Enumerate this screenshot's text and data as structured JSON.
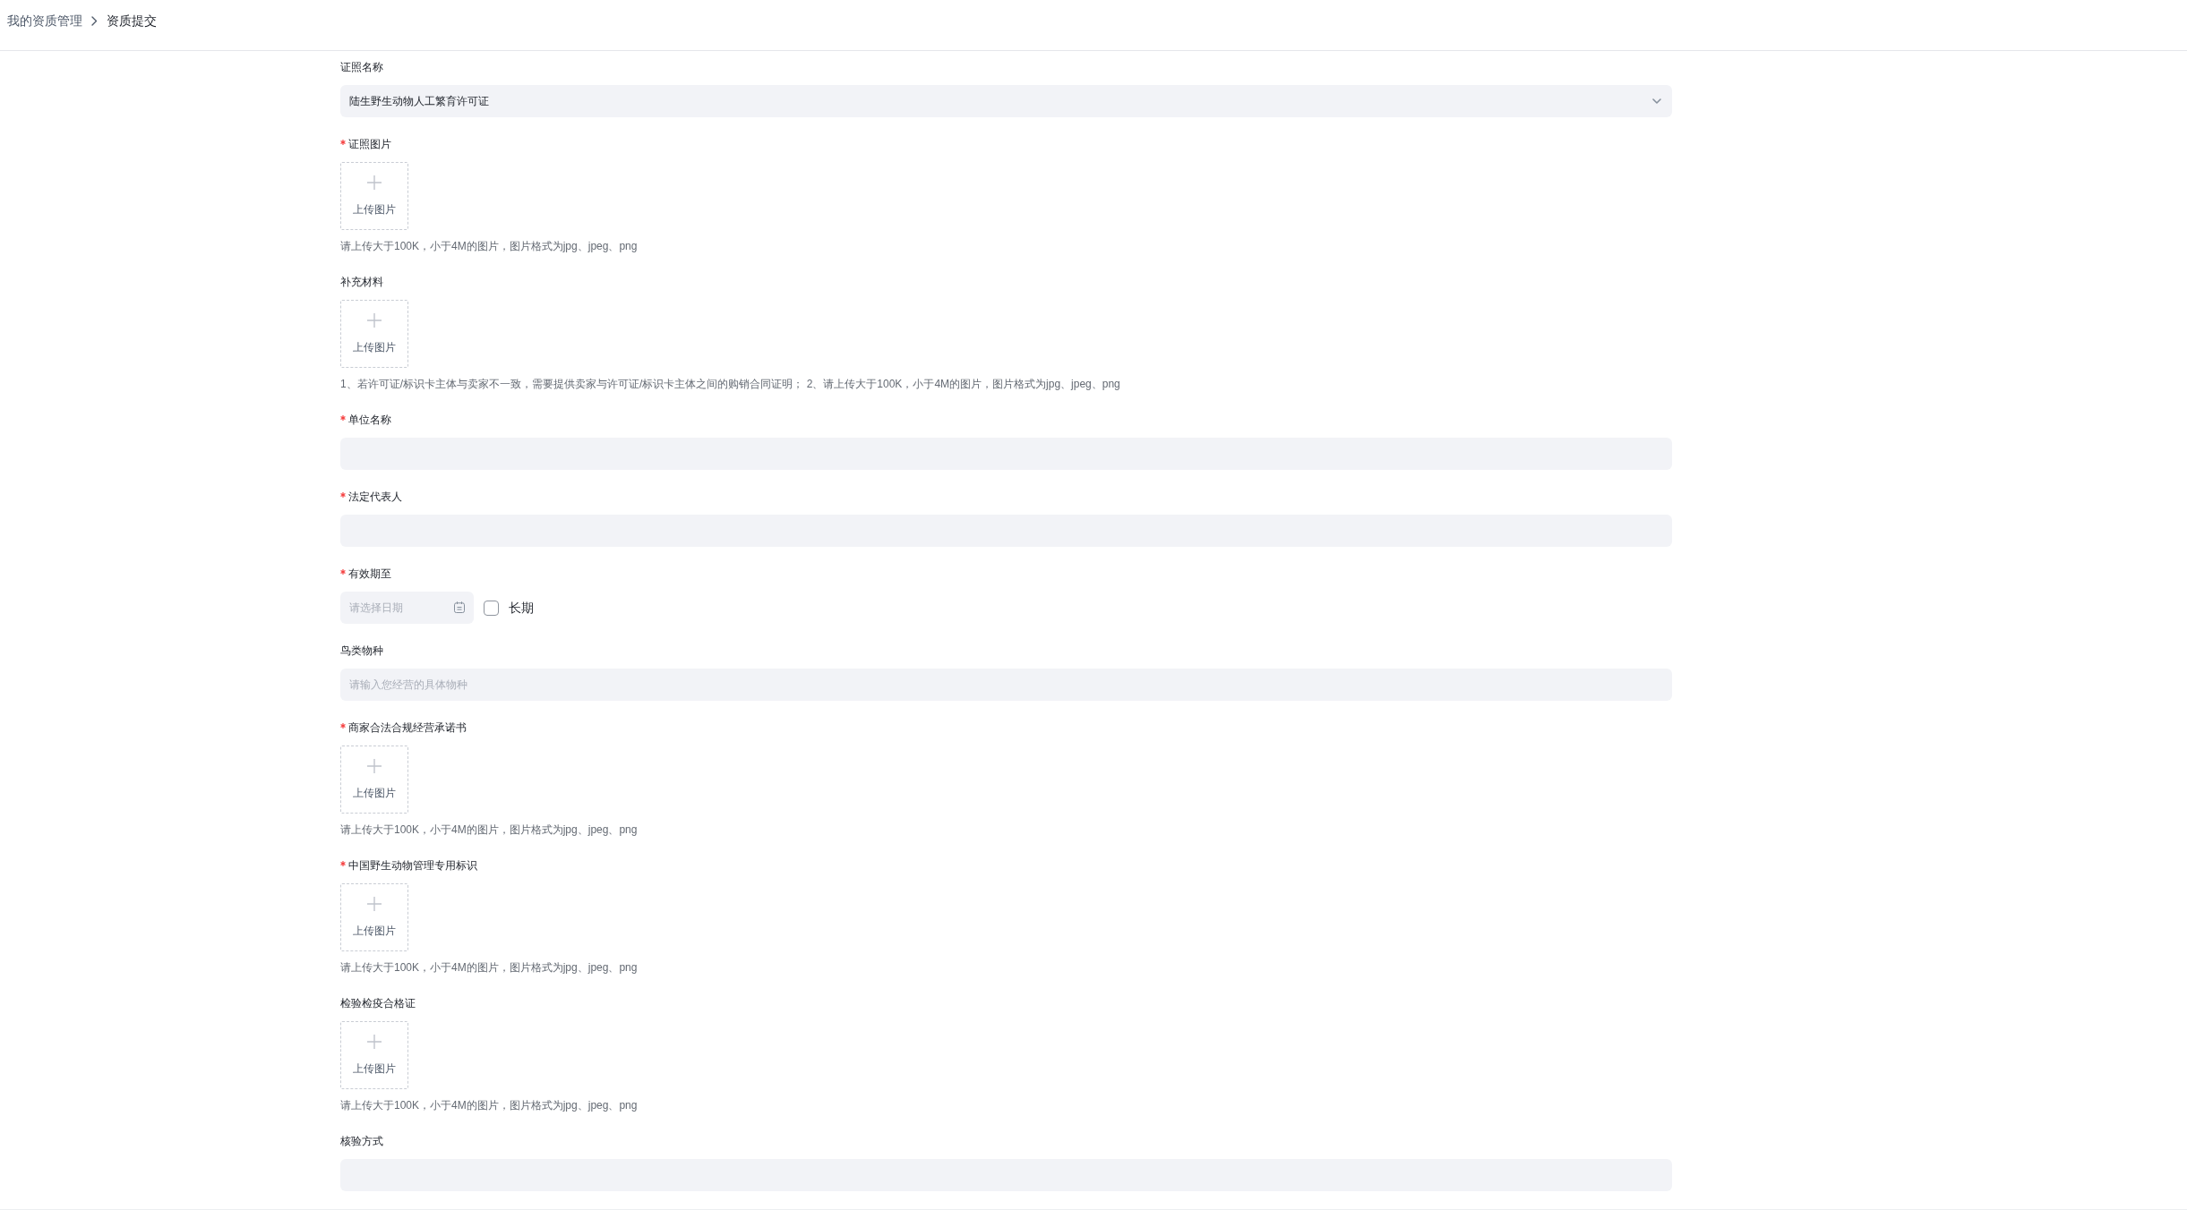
{
  "breadcrumb": [
    {
      "label": "我的资质管理",
      "current": false
    },
    {
      "label": "资质提交",
      "current": true
    }
  ],
  "form": {
    "fields": [
      {
        "kind": "select",
        "label": "证照名称",
        "required": false,
        "value": "陆生野生动物人工繁育许可证"
      },
      {
        "kind": "upload",
        "label": "证照图片",
        "required": true,
        "button": "上传图片",
        "hint": "请上传大于100K，小于4M的图片，图片格式为jpg、jpeg、png"
      },
      {
        "kind": "upload",
        "label": "补充材料",
        "required": false,
        "button": "上传图片",
        "hint": "1、若许可证/标识卡主体与卖家不一致，需要提供卖家与许可证/标识卡主体之间的购销合同证明； 2、请上传大于100K，小于4M的图片，图片格式为jpg、jpeg、png"
      },
      {
        "kind": "text",
        "label": "单位名称",
        "required": true
      },
      {
        "kind": "text",
        "label": "法定代表人",
        "required": true
      },
      {
        "kind": "date",
        "label": "有效期至",
        "required": true,
        "placeholder": "请选择日期",
        "checkbox": {
          "label": "长期",
          "checked": false
        }
      },
      {
        "kind": "text",
        "label": "鸟类物种",
        "required": false,
        "placeholder": "请输入您经营的具体物种"
      },
      {
        "kind": "upload",
        "label": "商家合法合规经营承诺书",
        "required": true,
        "button": "上传图片",
        "hint": "请上传大于100K，小于4M的图片，图片格式为jpg、jpeg、png"
      },
      {
        "kind": "upload",
        "label": "中国野生动物管理专用标识",
        "required": true,
        "button": "上传图片",
        "hint": "请上传大于100K，小于4M的图片，图片格式为jpg、jpeg、png"
      },
      {
        "kind": "upload",
        "label": "检验检疫合格证",
        "required": false,
        "button": "上传图片",
        "hint": "请上传大于100K，小于4M的图片，图片格式为jpg、jpeg、png"
      },
      {
        "kind": "text",
        "label": "核验方式",
        "required": false
      }
    ]
  }
}
